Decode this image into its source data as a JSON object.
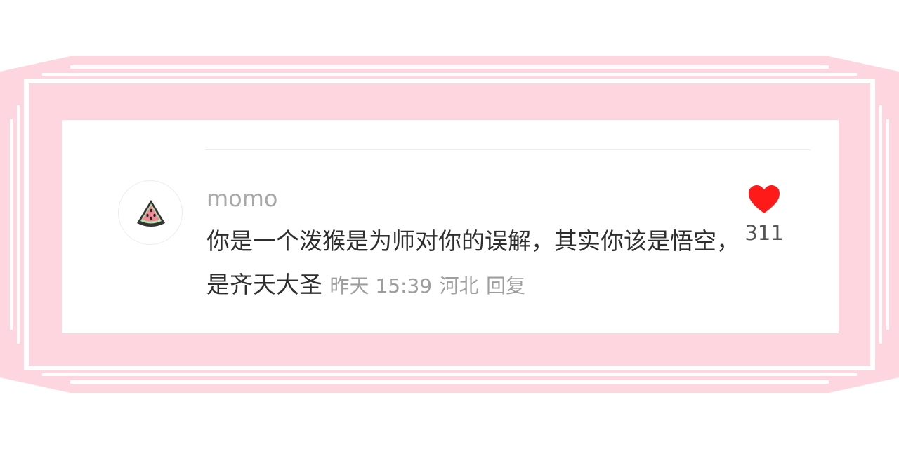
{
  "comment": {
    "username": "momo",
    "text": "你是一个泼猴是为师对你的误解，其实你该是悟空，是齐天大圣",
    "time": "昨天 15:39",
    "location": "河北",
    "reply_label": "回复",
    "likes": "311",
    "avatar_icon": "watermelon-icon",
    "like_icon": "heart-icon"
  },
  "colors": {
    "frame_pink": "#fdd6df",
    "heart": "#ff1a1a",
    "meta_gray": "#9e9e9e",
    "text": "#2e2e2e"
  }
}
